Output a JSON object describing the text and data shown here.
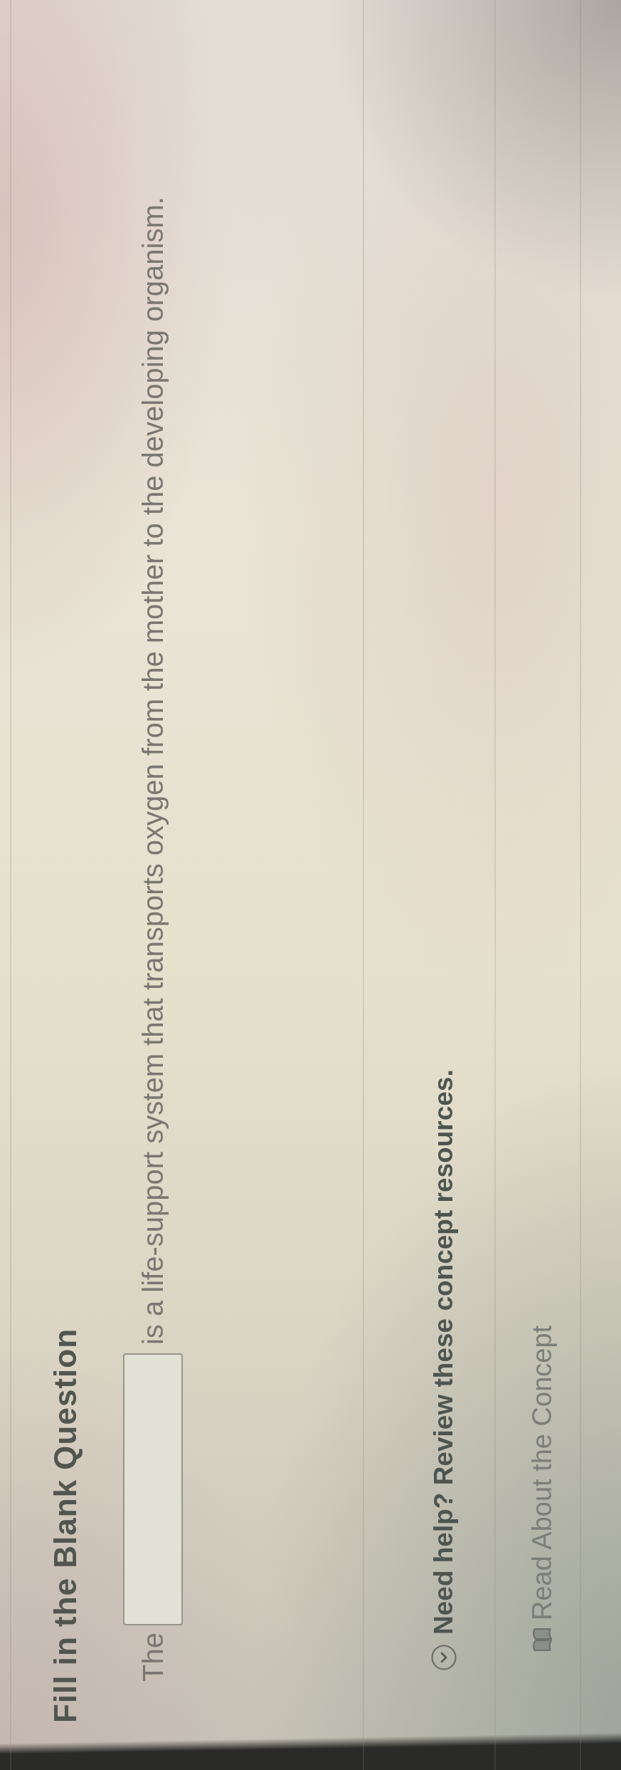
{
  "question": {
    "title": "Fill in the Blank Question",
    "prompt_before": "The",
    "prompt_after": "is a life-support system that transports oxygen from the mother to the developing organism."
  },
  "help": {
    "text": "Need help? Review these concept resources.",
    "expanded": true
  },
  "resources": [
    {
      "label": "Read About the Concept"
    }
  ]
}
